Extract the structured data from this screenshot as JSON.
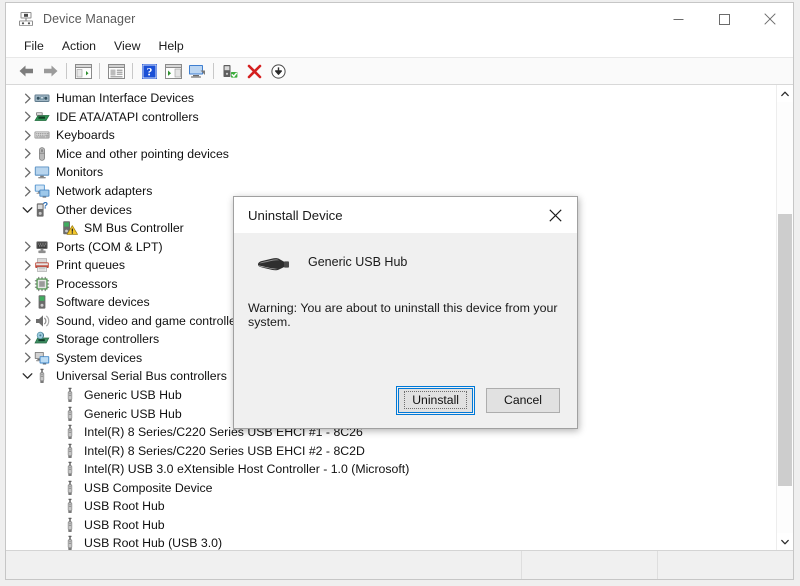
{
  "window": {
    "title": "Device Manager",
    "icon": "device-manager-icon",
    "controls": [
      {
        "name": "minimize",
        "glyph": "minimize-icon"
      },
      {
        "name": "maximize",
        "glyph": "maximize-icon"
      },
      {
        "name": "close",
        "glyph": "close-icon"
      }
    ]
  },
  "menu": {
    "items": [
      {
        "label": "File"
      },
      {
        "label": "Action"
      },
      {
        "label": "View"
      },
      {
        "label": "Help"
      }
    ]
  },
  "toolbar": {
    "buttons": [
      {
        "name": "back-icon"
      },
      {
        "name": "forward-icon"
      },
      {
        "name": "separator"
      },
      {
        "name": "show-hide-console-tree-icon"
      },
      {
        "name": "separator"
      },
      {
        "name": "properties-icon"
      },
      {
        "name": "separator"
      },
      {
        "name": "help-icon"
      },
      {
        "name": "show-hide-action-pane-icon"
      },
      {
        "name": "scan-for-hardware-changes-icon"
      },
      {
        "name": "separator"
      },
      {
        "name": "update-driver-icon"
      },
      {
        "name": "uninstall-device-icon"
      },
      {
        "name": "disable-device-icon"
      }
    ]
  },
  "tree": {
    "items": [
      {
        "label": "Human Interface Devices",
        "icon": "hid-icon",
        "level": 0,
        "expander": "collapsed"
      },
      {
        "label": "IDE ATA/ATAPI controllers",
        "icon": "ide-controller-icon",
        "level": 0,
        "expander": "collapsed"
      },
      {
        "label": "Keyboards",
        "icon": "keyboard-icon",
        "level": 0,
        "expander": "collapsed"
      },
      {
        "label": "Mice and other pointing devices",
        "icon": "mouse-icon",
        "level": 0,
        "expander": "collapsed"
      },
      {
        "label": "Monitors",
        "icon": "monitor-icon",
        "level": 0,
        "expander": "collapsed"
      },
      {
        "label": "Network adapters",
        "icon": "network-adapter-icon",
        "level": 0,
        "expander": "collapsed"
      },
      {
        "label": "Other devices",
        "icon": "other-device-icon",
        "level": 0,
        "expander": "expanded"
      },
      {
        "label": "SM Bus Controller",
        "icon": "unknown-device-warning-icon",
        "level": 1,
        "expander": "none"
      },
      {
        "label": "Ports (COM & LPT)",
        "icon": "port-icon",
        "level": 0,
        "expander": "collapsed"
      },
      {
        "label": "Print queues",
        "icon": "printer-icon",
        "level": 0,
        "expander": "collapsed"
      },
      {
        "label": "Processors",
        "icon": "processor-icon",
        "level": 0,
        "expander": "collapsed"
      },
      {
        "label": "Software devices",
        "icon": "software-device-icon",
        "level": 0,
        "expander": "collapsed"
      },
      {
        "label": "Sound, video and game controllers",
        "icon": "sound-icon",
        "level": 0,
        "expander": "collapsed"
      },
      {
        "label": "Storage controllers",
        "icon": "storage-controller-icon",
        "level": 0,
        "expander": "collapsed"
      },
      {
        "label": "System devices",
        "icon": "system-device-icon",
        "level": 0,
        "expander": "collapsed"
      },
      {
        "label": "Universal Serial Bus controllers",
        "icon": "usb-icon",
        "level": 0,
        "expander": "expanded"
      },
      {
        "label": "Generic USB Hub",
        "icon": "usb-icon",
        "level": 1,
        "expander": "none"
      },
      {
        "label": "Generic USB Hub",
        "icon": "usb-icon",
        "level": 1,
        "expander": "none"
      },
      {
        "label": "Intel(R) 8 Series/C220 Series USB EHCI #1 - 8C26",
        "icon": "usb-icon",
        "level": 1,
        "expander": "none"
      },
      {
        "label": "Intel(R) 8 Series/C220 Series USB EHCI #2 - 8C2D",
        "icon": "usb-icon",
        "level": 1,
        "expander": "none"
      },
      {
        "label": "Intel(R) USB 3.0 eXtensible Host Controller - 1.0 (Microsoft)",
        "icon": "usb-icon",
        "level": 1,
        "expander": "none"
      },
      {
        "label": "USB Composite Device",
        "icon": "usb-icon",
        "level": 1,
        "expander": "none"
      },
      {
        "label": "USB Root Hub",
        "icon": "usb-icon",
        "level": 1,
        "expander": "none"
      },
      {
        "label": "USB Root Hub",
        "icon": "usb-icon",
        "level": 1,
        "expander": "none"
      },
      {
        "label": "USB Root Hub (USB 3.0)",
        "icon": "usb-icon",
        "level": 1,
        "expander": "none"
      }
    ]
  },
  "scrollbar": {
    "up_arrow": "chevron-up-icon",
    "down_arrow": "chevron-down-icon",
    "thumb_top_pct": 26,
    "thumb_height_pct": 63
  },
  "statusbar": {
    "text": "",
    "pane_b": "",
    "pane_c": ""
  },
  "dialog": {
    "title": "Uninstall Device",
    "close_icon": "close-icon",
    "device_icon": "usb-plug-icon",
    "device_name": "Generic USB Hub",
    "warning": "Warning: You are about to uninstall this device from your system.",
    "buttons": {
      "primary": "Uninstall",
      "secondary": "Cancel"
    },
    "focus_color": "#0078d7"
  }
}
